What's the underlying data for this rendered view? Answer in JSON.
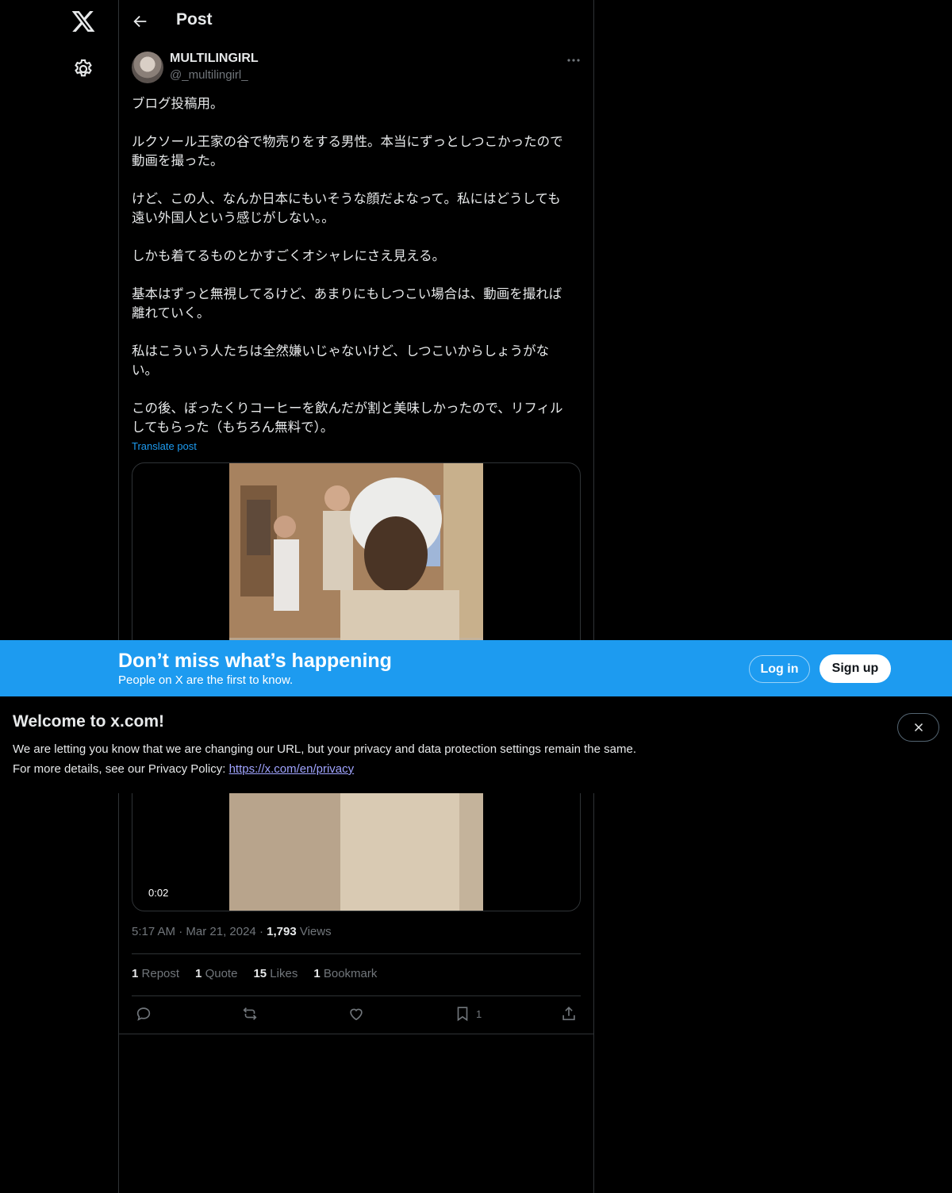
{
  "header": {
    "title": "Post"
  },
  "post": {
    "author_name": "MULTILINGIRL",
    "author_handle": "@_multilingirl_",
    "paragraphs": [
      "ブログ投稿用。",
      "ルクソール王家の谷で物売りをする男性。本当にずっとしつこかったので\n動画を撮った。",
      "けど、この人、なんか日本にもいそうな顔だよなって。私にはどうしても\n遠い外国人という感じがしない。。",
      "しかも着てるものとかすごくオシャレにさえ見える。",
      "基本はずっと無視してるけど、あまりにもしつこい場合は、動画を撮れば\n離れていく。",
      "私はこういう人たちは全然嫌いじゃないけど、しつこいからしょうがな\nい。",
      "この後、ぼったくりコーヒーを飲んだが割と美味しかったので、リフィル\nしてもらった（もちろん無料で）。"
    ],
    "translate_label": "Translate post",
    "video_duration": "0:02",
    "time": "5:17 AM",
    "date": "Mar 21, 2024",
    "views_count": "1,793",
    "views_label": "Views",
    "stats": {
      "reposts": "1",
      "reposts_label": "Repost",
      "quotes": "1",
      "quotes_label": "Quote",
      "likes": "15",
      "likes_label": "Likes",
      "bookmarks": "1",
      "bookmarks_label": "Bookmark"
    },
    "bookmark_count": "1"
  },
  "banner": {
    "title": "Don’t miss what’s happening",
    "subtitle": "People on X are the first to know.",
    "login_label": "Log in",
    "signup_label": "Sign up"
  },
  "notice": {
    "title": "Welcome to x.com!",
    "line1": "We are letting you know that we are changing our URL, but your privacy and data protection settings remain the same.",
    "line2_prefix": "For more details, see our Privacy Policy: ",
    "link_text": "https://x.com/en/privacy"
  },
  "colors": {
    "accent": "#1d9bf0",
    "background": "#000000",
    "muted": "#71767b"
  }
}
